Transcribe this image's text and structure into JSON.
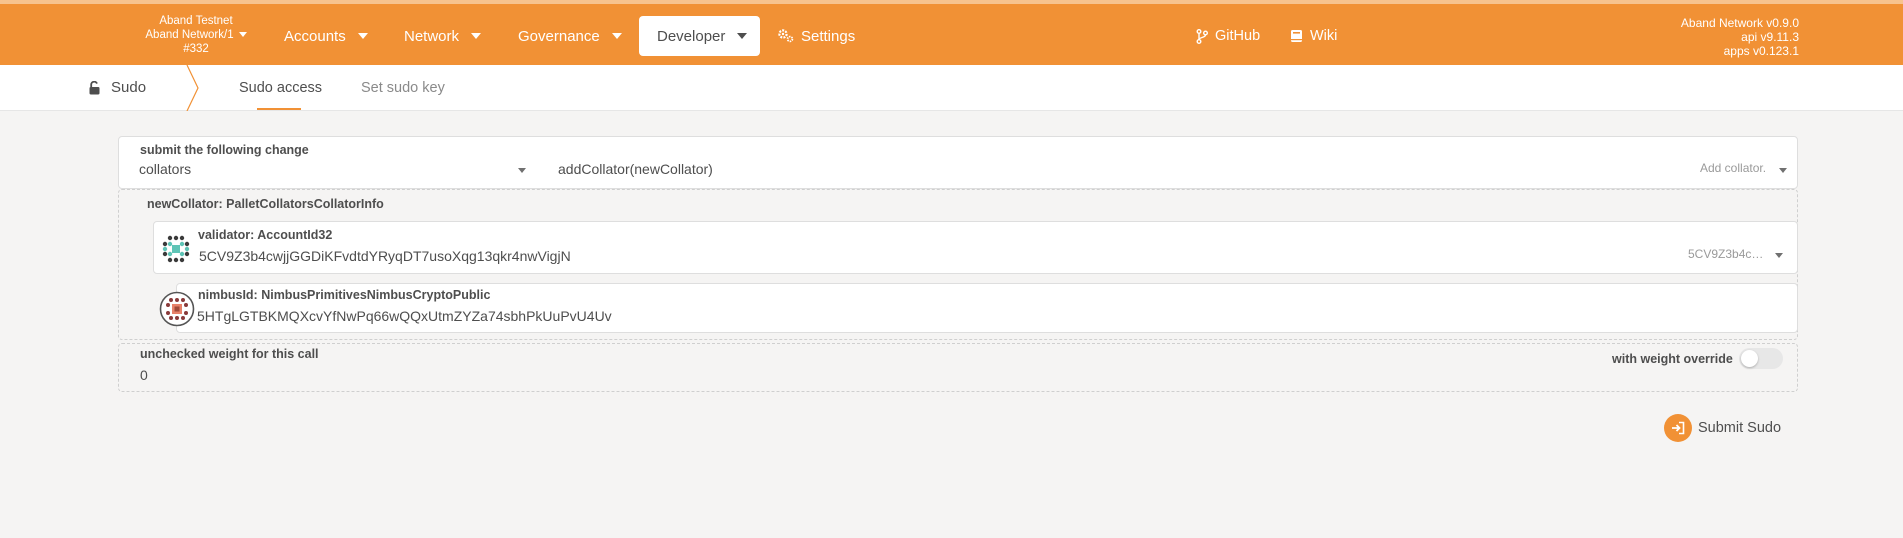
{
  "chain": {
    "name": "Aband Testnet",
    "network": "Aband Network/1",
    "block": "#332"
  },
  "menu": {
    "accounts": "Accounts",
    "network": "Network",
    "governance": "Governance",
    "developer": "Developer",
    "settings": "Settings",
    "github": "GitHub",
    "wiki": "Wiki"
  },
  "versions": {
    "node": "Aband Network v0.9.0",
    "api": "api v9.11.3",
    "apps": "apps v0.123.1"
  },
  "subnav": {
    "root": "Sudo",
    "tabs": [
      "Sudo access",
      "Set sudo key"
    ]
  },
  "form": {
    "submit_label": "submit the following change",
    "pallet": "collators",
    "call": "addCollator(newCollator)",
    "call_hint": "Add collator.",
    "param_label": "newCollator: PalletCollatorsCollatorInfo",
    "validator_label": "validator: AccountId32",
    "validator_value": "5CV9Z3b4cwjjGGDiKFvdtdYRyqDT7usoXqg13qkr4nwVigjN",
    "validator_short": "5CV9Z3b4c…",
    "nimbus_label": "nimbusId: NimbusPrimitivesNimbusCryptoPublic",
    "nimbus_value": "5HTgLGTBKMQXcvYfNwPq66wQQxUtmZYZa74sbhPkUuPvU4Uv",
    "weight_label": "unchecked weight for this call",
    "weight_value": "0",
    "override_label": "with weight override",
    "weight_override": false
  },
  "actions": {
    "submit": "Submit Sudo"
  },
  "colors": {
    "accent": "#f19135",
    "background": "#f5f4f3"
  },
  "icons": [
    "chevron-down-icon",
    "gear-icon",
    "github-branch-icon",
    "book-icon",
    "unlock-icon",
    "identicon",
    "sign-in-icon"
  ]
}
